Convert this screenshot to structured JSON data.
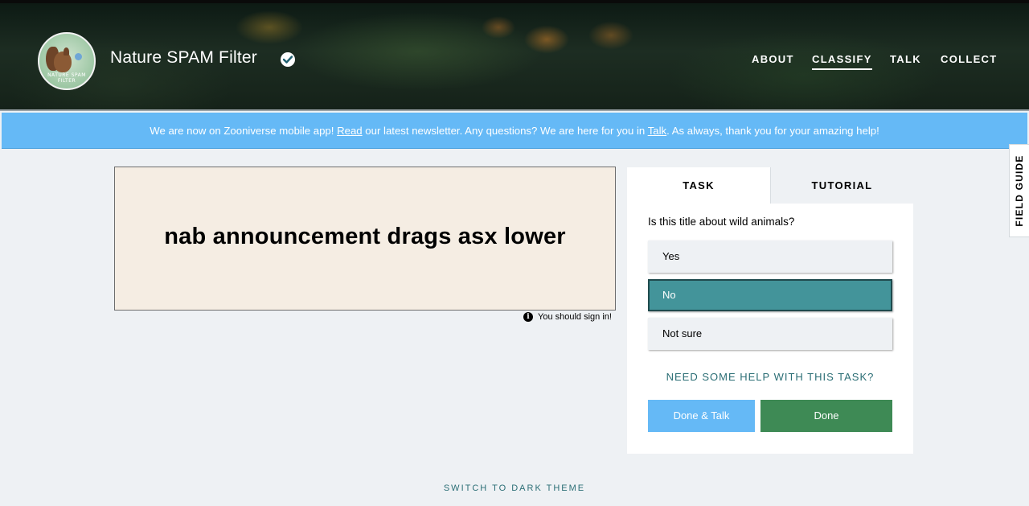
{
  "header": {
    "logo_text": "NATURE SPAM FILTER",
    "project_title": "Nature SPAM Filter",
    "nav": [
      {
        "label": "ABOUT",
        "active": false
      },
      {
        "label": "CLASSIFY",
        "active": true
      },
      {
        "label": "TALK",
        "active": false
      },
      {
        "label": "COLLECT",
        "active": false
      }
    ]
  },
  "announcement": {
    "part1": "We are now on Zooniverse mobile app! ",
    "link_read": "Read",
    "part2": " our latest newsletter. Any questions? We are here for you in ",
    "link_talk": "Talk",
    "part3": ". As always, thank you for your amazing help!"
  },
  "field_guide": {
    "label": "FIELD GUIDE"
  },
  "subject": {
    "text": "nab announcement drags asx lower",
    "sign_in_note": "You should sign in!"
  },
  "task_panel": {
    "tabs": [
      {
        "label": "TASK",
        "active": true
      },
      {
        "label": "TUTORIAL",
        "active": false
      }
    ],
    "question": "Is this title about wild animals?",
    "answers": [
      {
        "label": "Yes",
        "selected": false
      },
      {
        "label": "No",
        "selected": true
      },
      {
        "label": "Not sure",
        "selected": false
      }
    ],
    "help_link": "NEED SOME HELP WITH THIS TASK?",
    "done_talk_label": "Done & Talk",
    "done_label": "Done"
  },
  "footer": {
    "dark_theme_label": "SWITCH TO DARK THEME"
  },
  "colors": {
    "announcement_bg": "#65b9f6",
    "selected_answer": "#43949a",
    "done_button": "#3e8a55",
    "done_talk_button": "#65b9f6",
    "link_teal": "#2b6e75"
  }
}
